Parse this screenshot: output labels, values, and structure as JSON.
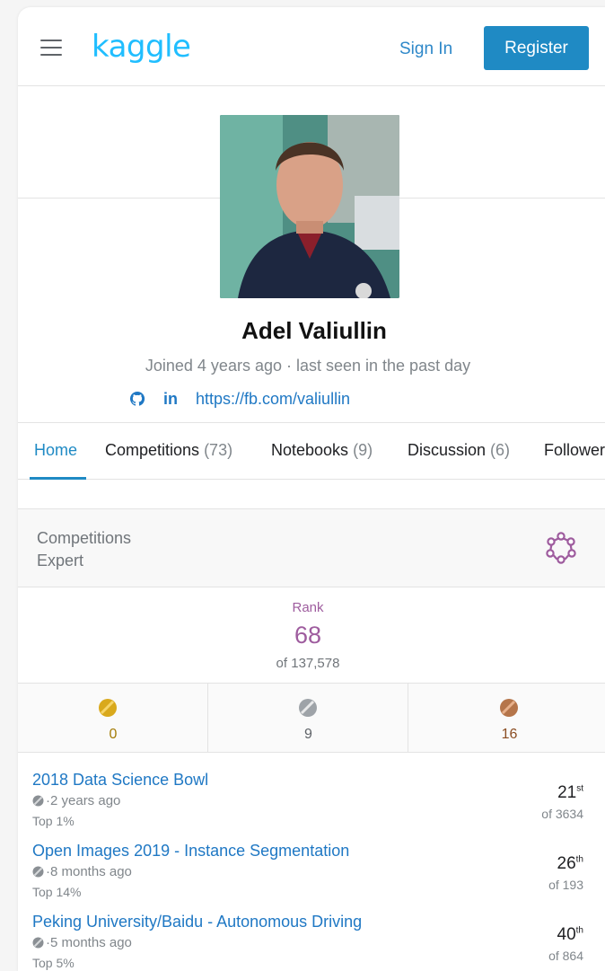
{
  "header": {
    "logo": "kaggle",
    "sign_in": "Sign In",
    "register": "Register"
  },
  "profile": {
    "name": "Adel Valiullin",
    "joined": "Joined 4 years ago · last seen in the past day",
    "github_icon": "github-icon",
    "linkedin_label": "in",
    "website": "https://fb.com/valiullin"
  },
  "tabs": [
    {
      "label": "Home",
      "count": ""
    },
    {
      "label": "Competitions",
      "count": "(73)"
    },
    {
      "label": "Notebooks",
      "count": "(9)"
    },
    {
      "label": "Discussion",
      "count": "(6)"
    },
    {
      "label": "Followers",
      "count": ""
    }
  ],
  "tier": {
    "line1": "Competitions",
    "line2": "Expert",
    "icon": "expert-tier-icon",
    "color": "#9e5c9e"
  },
  "rank": {
    "label": "Rank",
    "value": "68",
    "of": "of 137,578"
  },
  "medals": [
    {
      "type": "gold",
      "count": "0",
      "color": "#d9a91c",
      "text_color": "#a47c07"
    },
    {
      "type": "silver",
      "count": "9",
      "color": "#9ea3a8",
      "text_color": "#5f6368"
    },
    {
      "type": "bronze",
      "count": "16",
      "color": "#b5754a",
      "text_color": "#8b4d22"
    }
  ],
  "competitions": [
    {
      "title": "2018 Data Science Bowl",
      "age": "·2 years ago",
      "top": "Top 1%",
      "place": "21",
      "suffix": "st",
      "of": "of 3634"
    },
    {
      "title": "Open Images 2019 - Instance Segmentation",
      "age": "·8 months ago",
      "top": "Top 14%",
      "place": "26",
      "suffix": "th",
      "of": "of 193"
    },
    {
      "title": "Peking University/Baidu - Autonomous Driving",
      "age": "·5 months ago",
      "top": "Top 5%",
      "place": "40",
      "suffix": "th",
      "of": "of 864"
    }
  ]
}
